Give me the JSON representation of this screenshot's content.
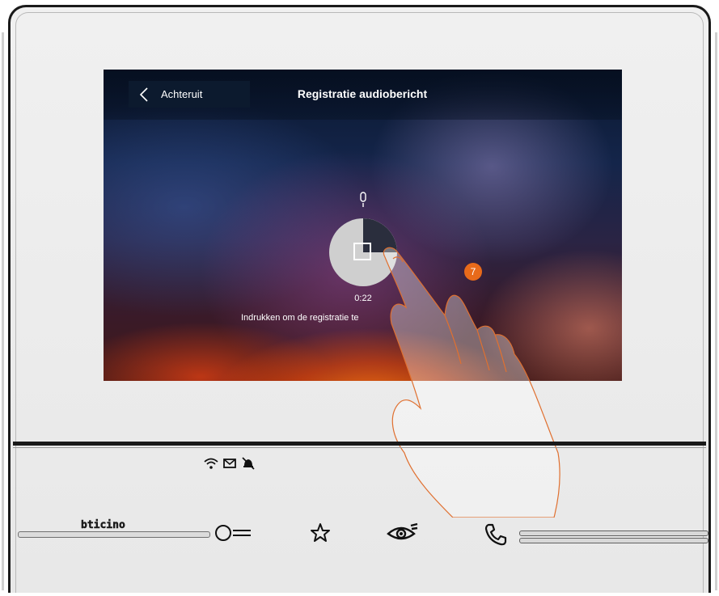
{
  "device": {
    "brand": "bticino",
    "screen": {
      "back_label": "Achteruit",
      "title": "Registratie audiobericht",
      "timer": "0:22",
      "hint": "Indrukken om de registratie te"
    },
    "step_badge": "7",
    "colors": {
      "accent": "#e86a1a",
      "recording_progress": "#2a2e3d"
    },
    "recording_progress_fraction": 0.25,
    "status_icons": [
      "wifi-icon",
      "envelope-icon",
      "bell-off-icon"
    ],
    "controls": [
      "door-key-icon",
      "star-icon",
      "eye-icon",
      "handset-icon"
    ]
  }
}
